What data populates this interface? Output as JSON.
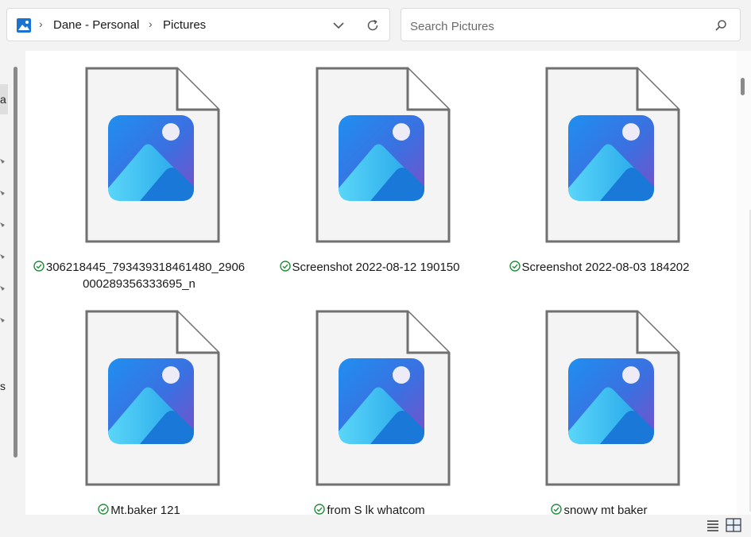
{
  "address": {
    "crumbs": [
      {
        "label": "Dane - Personal"
      },
      {
        "label": "Pictures"
      }
    ]
  },
  "search": {
    "placeholder": "Search Pictures"
  },
  "nav_fragments": {
    "item_a": "a",
    "item_s": "s"
  },
  "files": [
    {
      "name": "306218445_793439318461480_2906000289356333695_n",
      "status": "synced"
    },
    {
      "name": "Screenshot 2022-08-12 190150",
      "status": "synced"
    },
    {
      "name": "Screenshot 2022-08-03 184202",
      "status": "synced"
    },
    {
      "name": "Mt.baker 121",
      "status": "synced"
    },
    {
      "name": "from S lk whatcom",
      "status": "synced"
    },
    {
      "name": "snowy mt baker",
      "status": "synced"
    }
  ],
  "colors": {
    "sync_green": "#1f8f3a",
    "folder_blue": "#1a73d0"
  },
  "icons": {
    "location": "pictures-folder-icon",
    "dropdown": "chevron-down-icon",
    "refresh": "refresh-icon",
    "search": "search-icon",
    "details_view": "details-view-icon",
    "large_icons_view": "large-icons-view-icon"
  }
}
